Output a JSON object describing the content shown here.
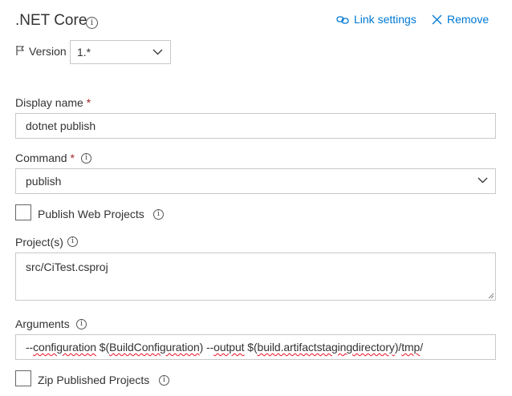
{
  "header": {
    "title": ".NET Core",
    "link_settings_label": "Link settings",
    "remove_label": "Remove"
  },
  "version": {
    "label": "Version",
    "selected": "1.*"
  },
  "display_name": {
    "label": "Display name",
    "required_mark": "*",
    "value": "dotnet publish"
  },
  "command": {
    "label": "Command",
    "required_mark": "*",
    "selected": "publish"
  },
  "publish_web_projects": {
    "label": "Publish Web Projects",
    "checked": false
  },
  "projects": {
    "label": "Project(s)",
    "value": "src/CiTest.csproj"
  },
  "arguments": {
    "label": "Arguments",
    "value": "--configuration $(BuildConfiguration) --output $(build.artifactstagingdirectory)/tmp/",
    "parts": [
      "--",
      "configuration",
      " $(",
      "BuildConfiguration",
      ") --",
      "output",
      " $(",
      "build.artifactstagingdirectory",
      ")/",
      "tmp",
      "/"
    ]
  },
  "zip_published_projects": {
    "label": "Zip Published Projects",
    "checked": false
  },
  "icons": {
    "info": "info-icon",
    "link": "link-icon",
    "close": "close-icon",
    "flag": "flag-icon",
    "chevron": "chevron-down-icon"
  },
  "colors": {
    "accent": "#0078d4",
    "required": "#a4262c",
    "border": "#c8c8c8",
    "spellcheck": "#e81123"
  }
}
